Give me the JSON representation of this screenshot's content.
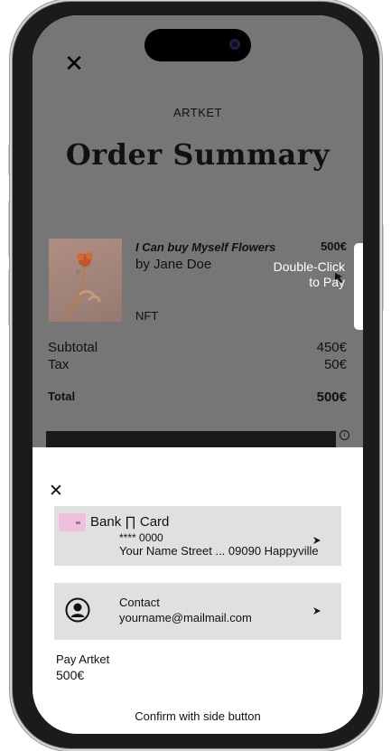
{
  "store": {
    "brand": "ARTKET",
    "title": "Order Summary",
    "close_icon": "close-icon"
  },
  "item": {
    "title": "I Can buy Myself Flowers",
    "artist": "by Jane Doe",
    "price": "500€",
    "type": "NFT"
  },
  "summary": {
    "subtotal_label": "Subtotal",
    "subtotal_value": "450€",
    "tax_label": "Tax",
    "tax_value": "50€",
    "total_label": "Total",
    "total_value": "500€"
  },
  "overlay": {
    "hint_line1": "Double-Click",
    "hint_line2": "to Pay"
  },
  "sheet": {
    "close_icon": "close-icon",
    "card": {
      "name": "Bank ∏ Card",
      "number": "**** 0000",
      "address": "Your Name Street ... 09090 Happyville"
    },
    "contact": {
      "label": "Contact",
      "email": "yourname@mailmail.com"
    },
    "pay_to": "Pay Artket",
    "pay_amount": "500€",
    "confirm_hint": "Confirm with side button"
  },
  "colors": {
    "dim_overlay": "#767676",
    "row_background": "#e0e0e0",
    "card_color": "#efbfdc"
  }
}
